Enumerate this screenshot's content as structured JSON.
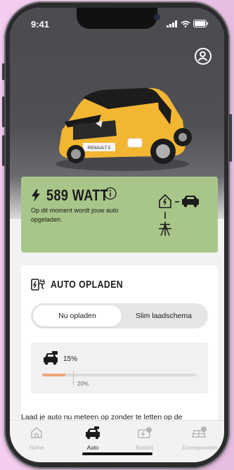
{
  "status_bar": {
    "time": "9:41"
  },
  "vehicle": {
    "plate": "RENAULT 5"
  },
  "power_card": {
    "value": "589 WATT",
    "description": "Op dit moment wordt jouw auto opgeladen."
  },
  "charging_section": {
    "title": "AUTO OPLADEN",
    "tabs": [
      {
        "label": "Nu opladen",
        "selected": true
      },
      {
        "label": "Slim laadschema",
        "selected": false
      }
    ],
    "battery": {
      "percent_label": "15%",
      "level": 0.15,
      "target_label": "20%",
      "target": 0.2
    },
    "info_text": "Laad je auto nu meteen op zonder te letten op de"
  },
  "tabbar": {
    "items": [
      {
        "label": "Home",
        "icon": "home-icon",
        "active": false
      },
      {
        "label": "Auto",
        "icon": "car-icon",
        "active": true
      },
      {
        "label": "Batterij",
        "icon": "battery-icon",
        "active": false
      },
      {
        "label": "Zonnepanelen",
        "icon": "solar-panel-icon",
        "active": false
      }
    ]
  },
  "colors": {
    "power_card_bg": "#a9c68a",
    "progress_fill": "#f4a279",
    "hero_bg": "#4f5054",
    "car_body": "#f2b632"
  }
}
